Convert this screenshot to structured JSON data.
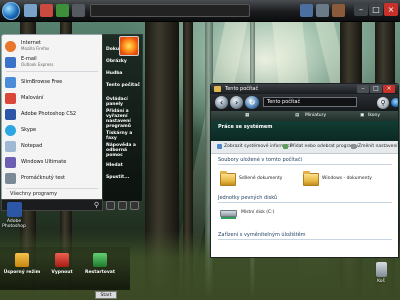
{
  "taskbar": {
    "search_placeholder": ""
  },
  "start_menu": {
    "pinned": [
      {
        "name": "Internet",
        "sub": "Mozilla Firefox",
        "icon": "firefox-icon",
        "color": "#e8762b"
      },
      {
        "name": "E-mail",
        "sub": "Outlook Express",
        "icon": "mail-icon",
        "color": "#3a73c8"
      }
    ],
    "recent": [
      {
        "name": "SlimBrowse Free",
        "icon": "browser-icon",
        "color": "#4b8bd8"
      },
      {
        "name": "Malování",
        "icon": "paint-icon",
        "color": "#d9473a"
      },
      {
        "name": "Adobe Photoshop CS2",
        "icon": "photoshop-icon",
        "color": "#2c57a6"
      },
      {
        "name": "Skype",
        "icon": "skype-icon",
        "color": "#2ba6e2"
      },
      {
        "name": "Notepad",
        "icon": "notepad-icon",
        "color": "#9fb8d4"
      },
      {
        "name": "Windows Ultimate",
        "icon": "windows-icon",
        "color": "#6a5fb3"
      },
      {
        "name": "Promáčknutý test",
        "icon": "test-icon",
        "color": "#7a8a96"
      }
    ],
    "all_programs": "Všechny programy",
    "right_items": [
      "Dokumenty",
      "Obrázky",
      "Hudba",
      "Tento počítač",
      "Ovládací panely",
      "Přidání a vyřazení nastavení programů",
      "Tiskárny a faxy",
      "Nápověda a odborná pomoc",
      "Hledat",
      "Spustit..."
    ]
  },
  "explorer": {
    "title": "Tento počítač",
    "address": "Tento počítač",
    "toolbar": {
      "views": "Miniatury",
      "icons": "Ikony"
    },
    "tasks_title": "Práce se systémem",
    "commands": [
      "Zobrazit systémové informace",
      "Přidat nebo odebrat programy",
      "Změnit nastavení"
    ],
    "groups": [
      {
        "header": "Soubory uložené v tomto počítači"
      },
      {
        "header": "Jednotky pevných disků"
      },
      {
        "header": "Zařízení s vyměnitelným úložištěm"
      }
    ],
    "files": [
      {
        "label": "Sdílené dokumenty"
      },
      {
        "label": "Windows - dokumenty"
      }
    ],
    "drives": [
      {
        "label": "Místní disk (C:)"
      }
    ]
  },
  "desktop": {
    "icons": [
      {
        "label": "Adobe Photoshop",
        "icon": "photoshop-icon"
      }
    ],
    "recycle_bin": "Koš"
  },
  "dock": {
    "items": [
      {
        "label": "Úsporný režim",
        "icon": "sleep-icon",
        "color": "#e0a11c"
      },
      {
        "label": "Vypnout",
        "icon": "power-icon",
        "color": "#d8342c"
      },
      {
        "label": "Restartovat",
        "icon": "restart-icon",
        "color": "#36a84a"
      }
    ],
    "start_button": "Start"
  }
}
